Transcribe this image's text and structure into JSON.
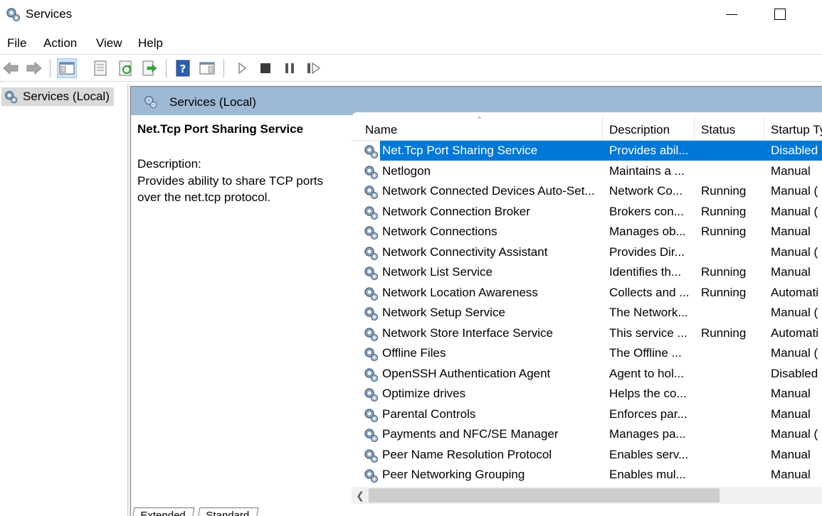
{
  "window": {
    "title": "Services",
    "icon": "gear-icon"
  },
  "menu": [
    "File",
    "Action",
    "View",
    "Help"
  ],
  "toolbar": {
    "buttons": [
      "back-icon",
      "forward-icon",
      "show-hide-console-tree-icon",
      "properties-icon",
      "refresh-icon",
      "export-list-icon",
      "help-icon",
      "show-hide-action-pane-icon",
      "play-icon",
      "stop-icon",
      "pause-icon",
      "restart-icon"
    ]
  },
  "tree": {
    "root": "Services (Local)"
  },
  "right_pane": {
    "header": "Services (Local)",
    "selected_service": {
      "name": "Net.Tcp Port Sharing Service",
      "description_label": "Description:",
      "description": "Provides ability to share TCP ports over the net.tcp protocol."
    },
    "columns": [
      "Name",
      "Description",
      "Status",
      "Startup Ty"
    ],
    "rows": [
      {
        "name": "Net.Tcp Port Sharing Service",
        "description": "Provides abil...",
        "status": "",
        "startup": "Disabled",
        "selected": true
      },
      {
        "name": "Netlogon",
        "description": "Maintains a ...",
        "status": "",
        "startup": "Manual"
      },
      {
        "name": "Network Connected Devices Auto-Set...",
        "description": "Network Co...",
        "status": "Running",
        "startup": "Manual ("
      },
      {
        "name": "Network Connection Broker",
        "description": "Brokers con...",
        "status": "Running",
        "startup": "Manual ("
      },
      {
        "name": "Network Connections",
        "description": "Manages ob...",
        "status": "Running",
        "startup": "Manual"
      },
      {
        "name": "Network Connectivity Assistant",
        "description": "Provides Dir...",
        "status": "",
        "startup": "Manual ("
      },
      {
        "name": "Network List Service",
        "description": "Identifies th...",
        "status": "Running",
        "startup": "Manual"
      },
      {
        "name": "Network Location Awareness",
        "description": "Collects and ...",
        "status": "Running",
        "startup": "Automati"
      },
      {
        "name": "Network Setup Service",
        "description": "The Network...",
        "status": "",
        "startup": "Manual ("
      },
      {
        "name": "Network Store Interface Service",
        "description": "This service ...",
        "status": "Running",
        "startup": "Automati"
      },
      {
        "name": "Offline Files",
        "description": "The Offline ...",
        "status": "",
        "startup": "Manual ("
      },
      {
        "name": "OpenSSH Authentication Agent",
        "description": "Agent to hol...",
        "status": "",
        "startup": "Disabled"
      },
      {
        "name": "Optimize drives",
        "description": "Helps the co...",
        "status": "",
        "startup": "Manual"
      },
      {
        "name": "Parental Controls",
        "description": "Enforces par...",
        "status": "",
        "startup": "Manual"
      },
      {
        "name": "Payments and NFC/SE Manager",
        "description": "Manages pa...",
        "status": "",
        "startup": "Manual ("
      },
      {
        "name": "Peer Name Resolution Protocol",
        "description": "Enables serv...",
        "status": "",
        "startup": "Manual"
      },
      {
        "name": "Peer Networking Grouping",
        "description": "Enables mul...",
        "status": "",
        "startup": "Manual"
      }
    ]
  },
  "tabs": [
    "Extended",
    "Standard"
  ]
}
